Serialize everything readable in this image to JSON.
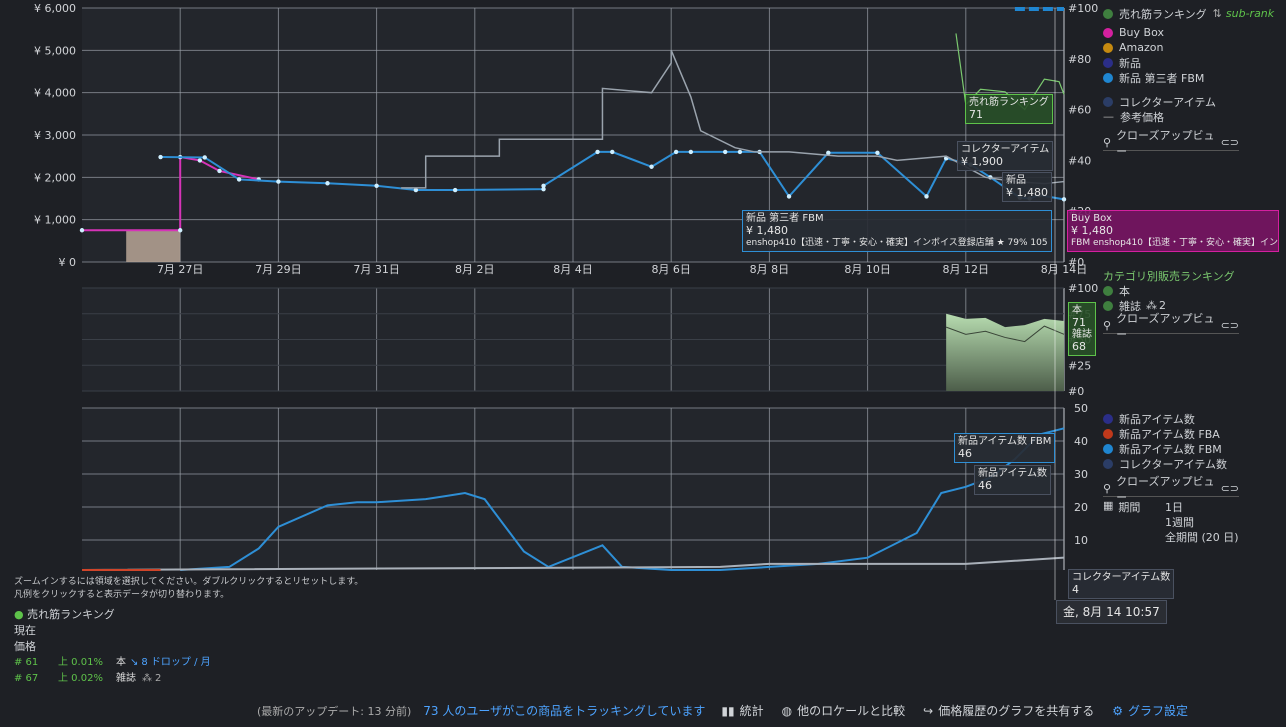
{
  "chart_data": [
    {
      "type": "line",
      "title": "",
      "y_left_ticks": [
        "¥ 6,000",
        "¥ 5,000",
        "¥ 4,000",
        "¥ 3,000",
        "¥ 2,000",
        "¥ 1,000",
        "¥ 0"
      ],
      "y_right_ticks": [
        "#100",
        "#80",
        "#60",
        "#40",
        "#20",
        "#0"
      ],
      "x_ticks": [
        "7月 27日",
        "7月 29日",
        "7月 31日",
        "8月 2日",
        "8月 4日",
        "8月 6日",
        "8月 8日",
        "8月 10日",
        "8月 12日",
        "8月 14日"
      ],
      "ylim": [
        0,
        6000
      ],
      "series": [
        {
          "name": "Buy Box",
          "color": "#d633b8",
          "x": [
            0.0,
            2.0,
            2.0,
            2.4,
            2.8,
            3.6
          ],
          "y": [
            750,
            750,
            2480,
            2400,
            2150,
            1950
          ]
        },
        {
          "name": "新品 第三者 FBM",
          "color": "#2e8fd6",
          "x": [
            1.6,
            2.5,
            3.2,
            4.0,
            5.0,
            6.0,
            6.8,
            7.6,
            9.4,
            9.4,
            10.5,
            10.8,
            11.6,
            12.1,
            12.4,
            13.1,
            13.4,
            13.8,
            14.4,
            15.2,
            16.2,
            17.2,
            17.6,
            18.1,
            18.5,
            19.1,
            19.3,
            19.5,
            20.0
          ],
          "y": [
            2480,
            2470,
            1950,
            1900,
            1860,
            1800,
            1700,
            1700,
            1720,
            1800,
            2600,
            2600,
            2250,
            2600,
            2600,
            2600,
            2600,
            2600,
            1550,
            2580,
            2580,
            1550,
            2450,
            2300,
            2000,
            1520,
            1500,
            1580,
            1480
          ]
        },
        {
          "name": "参考価格",
          "color": "#9aa3ad",
          "x": [
            6.5,
            7.0,
            7.0,
            8.5,
            8.5,
            9.4,
            10.6,
            10.6,
            11.6,
            12.0,
            12.0,
            12.4,
            12.6,
            13.3,
            13.7,
            14.4,
            15.4,
            16.2,
            16.6,
            17.6,
            18.4,
            19.0,
            19.6,
            20.0
          ],
          "y": [
            1750,
            1750,
            2500,
            2500,
            2900,
            2900,
            2900,
            4100,
            4000,
            4700,
            5000,
            3900,
            3100,
            2700,
            2600,
            2600,
            2500,
            2500,
            2400,
            2500,
            2000,
            1900,
            1850,
            1900
          ]
        }
      ],
      "rank_series": {
        "name": "売れ筋ランキング",
        "color": "#7bc96f",
        "points_x": [
          17.8,
          18.0,
          18.3,
          18.8,
          19.2,
          19.6,
          19.9,
          20.0
        ],
        "points_y": [
          90,
          62,
          68,
          67,
          60,
          72,
          71,
          66
        ]
      },
      "markers": [
        {
          "x": 2.0,
          "label": "7月 27日"
        }
      ],
      "tooltips": {
        "fbm": {
          "title": "新品 第三者 FBM",
          "value": "¥ 1,480",
          "seller": "enshop410【迅速・丁寧・安心・確実】インボイス登録店舗 ★ 79%  105"
        },
        "collector": {
          "title": "コレクターアイテム",
          "value": "¥ 1,900"
        },
        "new": {
          "title": "新品",
          "value": "¥ 1,480"
        },
        "rank": {
          "title": "売れ筋ランキング",
          "value": "71"
        },
        "buybox": {
          "title": "Buy Box",
          "value": "¥ 1,480",
          "seller": "FBM  enshop410【迅速・丁寧・安心・確実】インボ"
        }
      }
    },
    {
      "type": "area",
      "y_right_ticks": [
        "#100",
        "#75",
        "#50",
        "#25",
        "#0"
      ],
      "series": [
        {
          "name": "本",
          "x": [
            17.6,
            18.0,
            18.4,
            18.8,
            19.2,
            19.6,
            20.0
          ],
          "y": [
            75,
            70,
            71,
            62,
            64,
            70,
            68
          ]
        },
        {
          "name": "雑誌",
          "x": [
            17.6,
            18.0,
            18.4,
            18.8,
            19.2,
            19.6,
            20.0
          ],
          "y": [
            62,
            55,
            58,
            52,
            48,
            63,
            55
          ]
        }
      ],
      "tooltip": {
        "title": "本",
        "value": "71",
        "sub_title": "雑誌",
        "sub_value": "68"
      }
    },
    {
      "type": "line",
      "y_right_ticks": [
        "50",
        "40",
        "30",
        "20",
        "10"
      ],
      "ylim": [
        0,
        50
      ],
      "series": [
        {
          "name": "新品アイテム数 FBM",
          "color": "#2e8fd6",
          "x": [
            2.0,
            3.0,
            3.6,
            4.0,
            5.0,
            5.6,
            6.0,
            7.0,
            7.4,
            7.8,
            8.2,
            9.0,
            9.5,
            10.6,
            11.0,
            12.0,
            13.0,
            14.0,
            15.0,
            16.0,
            17.0,
            17.5,
            18.0,
            18.5,
            19.0,
            19.5,
            20.0
          ],
          "y": [
            0,
            1,
            7,
            14,
            21,
            22,
            22,
            23,
            24,
            25,
            23,
            6,
            1,
            8,
            1,
            0,
            0,
            1,
            2,
            4,
            12,
            25,
            27,
            30,
            36,
            44,
            46
          ]
        },
        {
          "name": "コレクターアイテム数",
          "color": "#aab1ba",
          "x": [
            0,
            13.0,
            14.0,
            16.0,
            18.0,
            19.0,
            20.0
          ],
          "y": [
            0,
            1,
            2,
            2,
            2,
            3,
            4
          ]
        },
        {
          "name": "新品アイテム数 FBA",
          "color": "#d0452a",
          "x": [
            0,
            1.6
          ],
          "y": [
            0,
            0
          ]
        }
      ],
      "tooltips": {
        "fbm": {
          "title": "新品アイテム数 FBM",
          "value": "46"
        },
        "new": {
          "title": "新品アイテム数",
          "value": "46"
        },
        "collector": {
          "title": "コレクターアイテム数",
          "value": "4"
        }
      }
    }
  ],
  "cursor_time": "金, 8月 14 10:57",
  "legend_top": {
    "sales_rank": "売れ筋ランキング",
    "sub_rank": "sub-rank",
    "buy_box": "Buy Box",
    "amazon": "Amazon",
    "new": "新品",
    "new_fbm": "新品 第三者 FBM",
    "collector": "コレクターアイテム",
    "reference": "参考価格",
    "closeup": "クローズアップビュー"
  },
  "legend_mid": {
    "title": "カテゴリ別販売ランキング",
    "book": "本",
    "magazine": "雑誌",
    "magazine_num": "2",
    "closeup": "クローズアップビュー"
  },
  "legend_bottom": {
    "new_count": "新品アイテム数",
    "new_count_fba": "新品アイテム数 FBA",
    "new_count_fbm": "新品アイテム数 FBM",
    "collector_count": "コレクターアイテム数",
    "closeup": "クローズアップビュー",
    "period": "期間",
    "period_1d": "1日",
    "period_1w": "1週間",
    "period_all": "全期間 (20 日)"
  },
  "colors": {
    "sales_rank": "#3f7f3f",
    "buy_box": "#d4209f",
    "amazon": "#c58a10",
    "new": "#2b2e88",
    "new_fbm": "#1f86d1",
    "collector": "#2b3d66",
    "fba": "#c0391b",
    "green": "#5ec24a"
  },
  "help": {
    "line1": "ズームインするには領域を選択してください。ダブルクリックするとリセットします。",
    "line2": "凡例をクリックすると表示データが切り替わります。"
  },
  "stats": {
    "title": "売れ筋ランキング",
    "current": "現在",
    "price": "価格",
    "rows": [
      {
        "rank": "# 61",
        "change": "上 0.01%",
        "cat": "本",
        "drop": "8 ドロップ / 月"
      },
      {
        "rank": "# 67",
        "change": "上 0.02%",
        "cat": "雑誌",
        "drop": "2"
      }
    ]
  },
  "footer": {
    "updated": "(最新のアップデート: 13 分前)",
    "tracking": "73 人のユーザがこの商品をトラッキングしています",
    "stats": "統計",
    "compare": "他のロケールと比較",
    "share": "価格履歴のグラフを共有する",
    "settings": "グラフ設定"
  }
}
